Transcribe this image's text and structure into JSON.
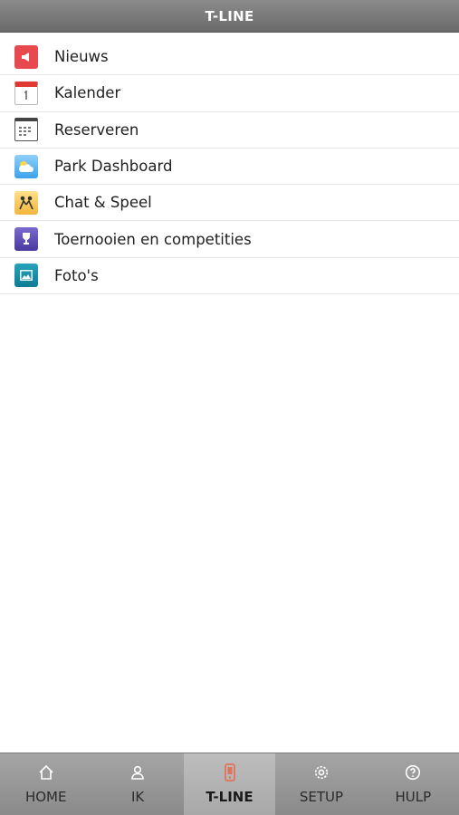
{
  "header": {
    "title": "T-LINE"
  },
  "menu": {
    "items": [
      {
        "label": "Nieuws",
        "icon": "news-megaphone-icon"
      },
      {
        "label": "Kalender",
        "icon": "calendar-icon"
      },
      {
        "label": "Reserveren",
        "icon": "reservation-calendar-icon"
      },
      {
        "label": "Park Dashboard",
        "icon": "weather-cloud-icon"
      },
      {
        "label": "Chat & Speel",
        "icon": "chat-play-icon"
      },
      {
        "label": "Toernooien en competities",
        "icon": "trophy-icon"
      },
      {
        "label": "Foto's",
        "icon": "photo-icon"
      }
    ]
  },
  "tabbar": {
    "tabs": [
      {
        "label": "HOME",
        "icon": "home-icon"
      },
      {
        "label": "IK",
        "icon": "user-icon"
      },
      {
        "label": "T-LINE",
        "icon": "phone-icon",
        "active": true
      },
      {
        "label": "SETUP",
        "icon": "gear-icon"
      },
      {
        "label": "HULP",
        "icon": "help-icon"
      }
    ]
  },
  "colors": {
    "active_tab_icon": "#e2735a",
    "header_bg": "#777777",
    "tabbar_bg": "#999999"
  }
}
